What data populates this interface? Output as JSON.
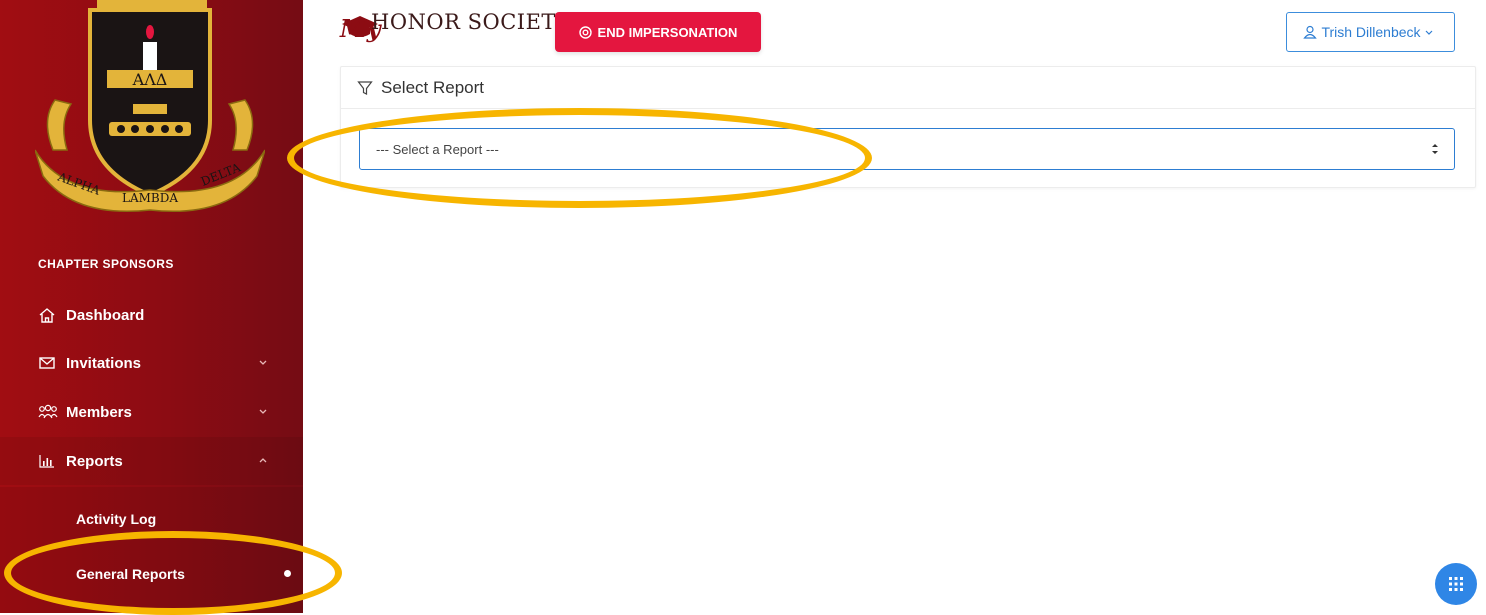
{
  "app": {
    "brand_prefix": "My",
    "brand_name": "HONOR SOCIETY"
  },
  "header": {
    "end_impersonation": "END IMPERSONATION",
    "user_name": "Trish Dillenbeck"
  },
  "crest": {
    "letters": "ΑΛΔ",
    "ribbon_left": "ALPHA",
    "ribbon_center": "LAMBDA",
    "ribbon_right": "DELTA"
  },
  "sidebar": {
    "section_title": "CHAPTER SPONSORS",
    "items": [
      {
        "label": "Dashboard",
        "icon": "home-icon"
      },
      {
        "label": "Invitations",
        "icon": "mail-icon",
        "expandable": true
      },
      {
        "label": "Members",
        "icon": "users-icon",
        "expandable": true
      },
      {
        "label": "Reports",
        "icon": "bar-chart-icon",
        "expandable": true,
        "expanded": true
      }
    ],
    "submenu": [
      {
        "label": "Activity Log"
      },
      {
        "label": "General Reports",
        "active": true
      }
    ]
  },
  "card": {
    "title": "Select Report",
    "select_value": "--- Select a Report ---"
  },
  "colors": {
    "sidebar": "#8c0c13",
    "accent_red": "#e4163f",
    "accent_blue": "#2d7dd2",
    "highlight": "#f7b500"
  }
}
